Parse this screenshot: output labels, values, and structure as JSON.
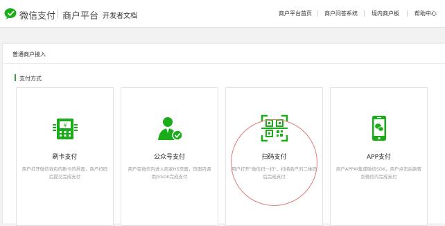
{
  "header": {
    "brand": "微信支付",
    "brand2": "商户平台",
    "devdoc": "开发者文档",
    "nav": [
      "商户平台首页",
      "商户问答系统",
      "境内商户板",
      "帮助中心"
    ]
  },
  "panel": {
    "title": "普通商户接入",
    "section_title": "支付方式"
  },
  "cards": [
    {
      "title": "刷卡支付",
      "desc": "用户打开微信钱包的刷卡的界面，商户扫码后提交完成支付",
      "icon": "card-reader-icon"
    },
    {
      "title": "公众号支付",
      "desc": "用户在微信内进入商家H5页面，页面内调用JSSDK完成支付",
      "icon": "official-account-user-icon"
    },
    {
      "title": "扫码支付",
      "desc": "用户打开\"微信扫一扫\"，扫描商户的二维码后完成支付",
      "icon": "qr-scan-icon"
    },
    {
      "title": "APP支付",
      "desc": "商户APP中集成微信SDK，用户点击后跳转到微信内完成支付",
      "icon": "phone-wechat-icon"
    }
  ],
  "colors": {
    "accent": "#1aad19",
    "annotation_circle": "#e27a7a"
  }
}
